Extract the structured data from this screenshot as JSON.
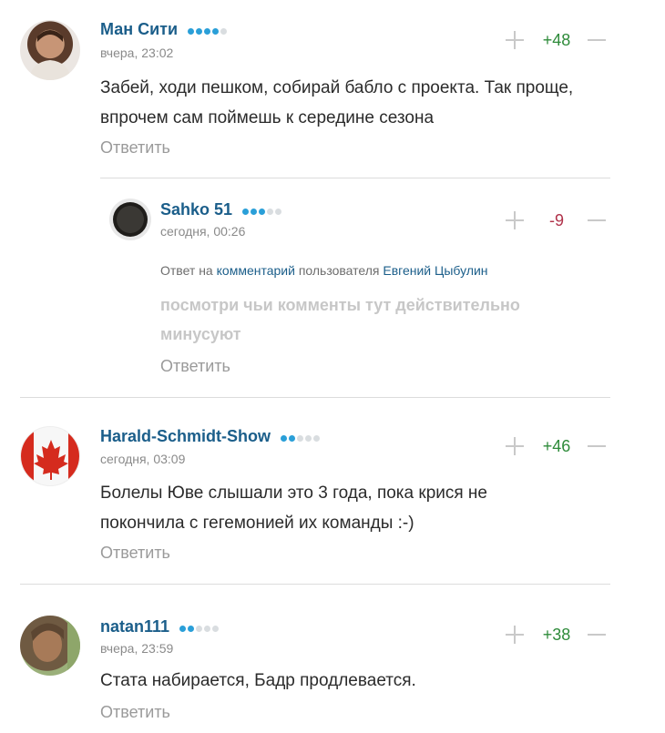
{
  "comments": [
    {
      "author": "Ман Сити",
      "rank_dots": [
        1,
        1,
        1,
        1,
        0
      ],
      "time": "вчера, 23:02",
      "score": "+48",
      "score_color": "#2e8b3a",
      "text_lines": [
        "Забей, ходи пешком, собирай бабло с проекта. Так проще,",
        "впрочем сам поймешь к середине сезона"
      ],
      "reply_label": "Ответить",
      "avatar_icon": "user-photo-icon"
    },
    {
      "author": "Sahko 51",
      "rank_dots": [
        1,
        1,
        1,
        0,
        0
      ],
      "time": "сегодня, 00:26",
      "score": "-9",
      "score_color": "#b0324a",
      "reply_context": {
        "prefix": "Ответ на",
        "comment_link": "комментарий",
        "middle": "пользователя",
        "user_link": "Евгений Цыбулин"
      },
      "text_lines": [
        "посмотри чьи комменты тут действительно",
        "минусуют"
      ],
      "reply_label": "Ответить",
      "avatar_icon": "user-logo-icon"
    },
    {
      "author": "Harald-Schmidt-Show",
      "rank_dots": [
        1,
        1,
        0,
        0,
        0
      ],
      "time": "сегодня, 03:09",
      "score": "+46",
      "score_color": "#2e8b3a",
      "text_lines": [
        "Болелы Юве слышали это 3 года, пока крися не",
        "покончила с гегемонией их команды :-)"
      ],
      "reply_label": "Ответить",
      "avatar_icon": "canada-flag-icon"
    },
    {
      "author": "natan111",
      "rank_dots": [
        1,
        1,
        0,
        0,
        0
      ],
      "time": "вчера, 23:59",
      "score": "+38",
      "score_color": "#2e8b3a",
      "text_lines": [
        "Стата набирается, Бадр продлевается."
      ],
      "reply_label": "Ответить",
      "avatar_icon": "user-photo-icon"
    }
  ]
}
